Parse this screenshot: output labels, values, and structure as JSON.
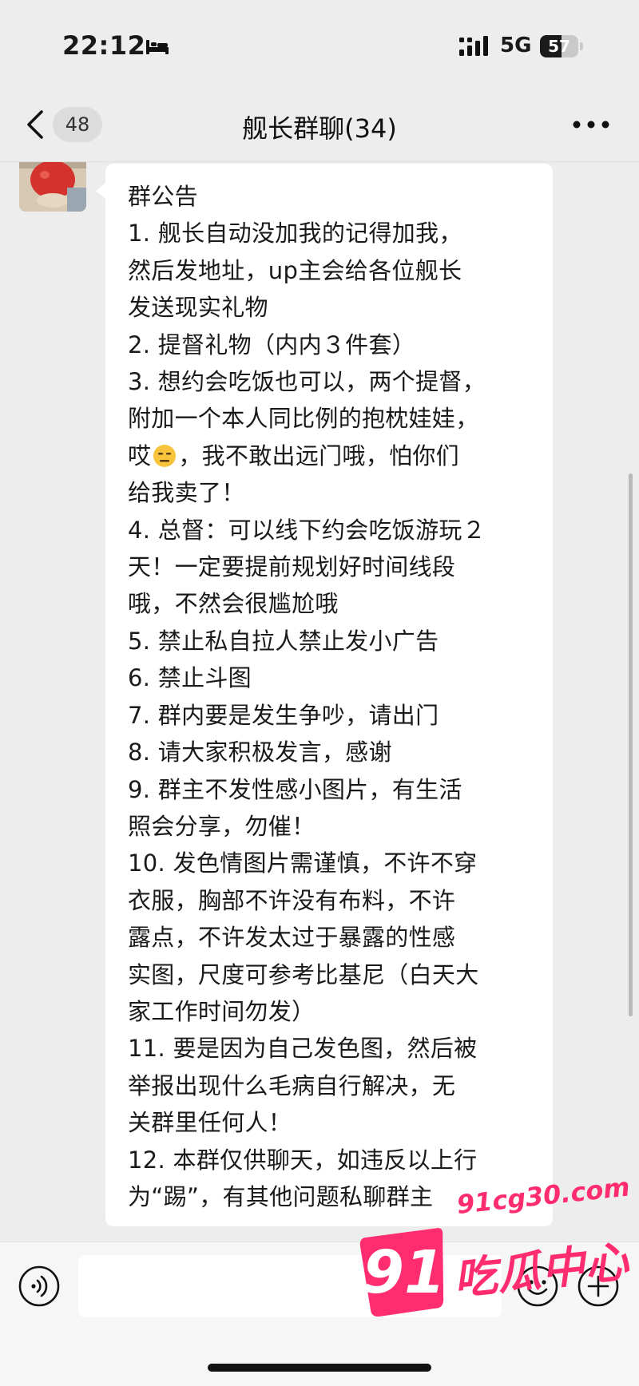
{
  "status_bar": {
    "time": "22:12",
    "network": "5G",
    "battery_level": "57"
  },
  "nav": {
    "unread_count": "48",
    "title": "舰长群聊(34)"
  },
  "message": {
    "lines": [
      "群公告",
      "1. 舰长自动没加我的记得加我，",
      "然后发地址，up主会给各位舰长",
      "发送现实礼物",
      "2. 提督礼物（内内３件套）",
      "3. 想约会吃饭也可以，两个提督，",
      "附加一个本人同比例的抱枕娃娃，",
      "哎",
      "，我不敢出远门哦，怕你们",
      "给我卖了！",
      "4. 总督：可以线下约会吃饭游玩２",
      "天！一定要提前规划好时间线段",
      "哦，不然会很尴尬哦",
      "5. 禁止私自拉人禁止发小广告",
      "6. 禁止斗图",
      "7. 群内要是发生争吵，请出门",
      "8. 请大家积极发言，感谢",
      "9. 群主不发性感小图片，有生活",
      "照会分享，勿催！",
      "10. 发色情图片需谨慎，不许不穿",
      "衣服，胸部不许没有布料，不许",
      "露点，不许发太过于暴露的性感",
      "实图，尺度可参考比基尼（白天大",
      "家工作时间勿发）",
      "11. 要是因为自己发色图，然后被",
      "举报出现什么毛病自行解决，无",
      "关群里任何人！",
      "12. 本群仅供聊天，如违反以上行",
      "为“踢”，有其他问题私聊群主"
    ]
  },
  "watermark": {
    "logo_text": "91",
    "url": "91cg30.com",
    "tagline": "吃瓜中心"
  },
  "colors": {
    "background": "#ededed",
    "bubble": "#ffffff",
    "watermark": "#ff2d6f"
  },
  "icons": [
    "bed-icon",
    "signal-icon",
    "back-icon",
    "more-icon",
    "voice-icon",
    "emoji-icon",
    "add-icon",
    "expressionless-face-emoji"
  ]
}
